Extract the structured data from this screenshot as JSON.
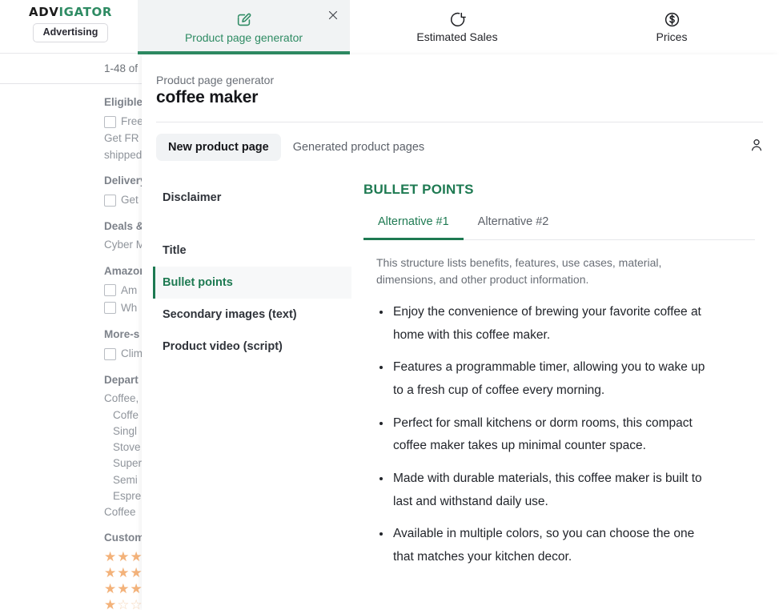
{
  "background": {
    "brand": {
      "part1": "ADV",
      "part2": "IGATOR",
      "pill_label": "Advertising"
    },
    "result_count": "1-48 of",
    "filters": [
      {
        "type": "heading",
        "label": "Eligible"
      },
      {
        "type": "checkbox",
        "label": "Free"
      },
      {
        "type": "text",
        "label": "Get FR"
      },
      {
        "type": "text",
        "label": "shipped"
      },
      {
        "type": "heading",
        "label": "Delivery"
      },
      {
        "type": "checkbox",
        "label": "Get"
      },
      {
        "type": "heading",
        "label": "Deals &"
      },
      {
        "type": "text",
        "label": "Cyber M"
      },
      {
        "type": "heading",
        "label": "Amazon"
      },
      {
        "type": "checkbox",
        "label": "Am"
      },
      {
        "type": "checkbox",
        "label": "Wh"
      },
      {
        "type": "heading",
        "label": "More-s"
      },
      {
        "type": "checkbox",
        "label": "Clim"
      },
      {
        "type": "heading",
        "label": "Depart"
      },
      {
        "type": "dep",
        "label": "Coffee,"
      },
      {
        "type": "dep-indent",
        "label": "Coffe"
      },
      {
        "type": "dep-indent",
        "label": "Singl"
      },
      {
        "type": "dep-indent",
        "label": "Stove"
      },
      {
        "type": "dep-indent",
        "label": "Super"
      },
      {
        "type": "dep-indent",
        "label": "Semi"
      },
      {
        "type": "dep-indent",
        "label": "Espre"
      },
      {
        "type": "dep",
        "label": "Coffee"
      },
      {
        "type": "heading",
        "label": "Custom"
      },
      {
        "type": "stars",
        "filled": 2,
        "empty": 0
      },
      {
        "type": "stars",
        "filled": 2,
        "empty": 0
      },
      {
        "type": "stars",
        "filled": 2,
        "empty": 0
      },
      {
        "type": "stars",
        "filled": 1,
        "empty": 1
      }
    ]
  },
  "tabstrip": {
    "tabs": [
      {
        "label": "Product page generator",
        "icon": "pencil-square-icon",
        "active": true
      },
      {
        "label": "Estimated Sales",
        "icon": "pie-chart-icon",
        "active": false
      },
      {
        "label": "Prices",
        "icon": "dollar-circle-icon",
        "active": false
      }
    ],
    "close_label": "close-icon"
  },
  "panel": {
    "kicker": "Product page generator",
    "title": "coffee maker",
    "segments": [
      {
        "label": "New product page",
        "active": true
      },
      {
        "label": "Generated product pages",
        "active": false
      }
    ],
    "account_icon": "user-icon",
    "side_nav": [
      {
        "label": "Disclaimer",
        "active": false
      },
      {
        "label": "Title",
        "active": false
      },
      {
        "label": "Bullet points",
        "active": true
      },
      {
        "label": "Secondary images (text)",
        "active": false
      },
      {
        "label": "Product video (script)",
        "active": false
      }
    ],
    "content": {
      "heading": "BULLET POINTS",
      "alt_tabs": [
        {
          "label": "Alternative #1",
          "active": true
        },
        {
          "label": "Alternative #2",
          "active": false
        }
      ],
      "structure_note": "This structure lists benefits, features, use cases, material, dimensions, and other product information.",
      "bullets": [
        "Enjoy the convenience of brewing your favorite coffee at home with this coffee maker.",
        "Features a programmable timer, allowing you to wake up to a fresh cup of coffee every morning.",
        "Perfect for small kitchens or dorm rooms, this compact coffee maker takes up minimal counter space.",
        "Made with durable materials, this coffee maker is built to last and withstand daily use.",
        "Available in multiple colors, so you can choose the one that matches your kitchen decor."
      ]
    }
  },
  "colors": {
    "brand_green": "#2e8b63",
    "accent_green": "#1e7a52",
    "star_orange": "#f3b27a",
    "muted_text": "#8f949b"
  }
}
